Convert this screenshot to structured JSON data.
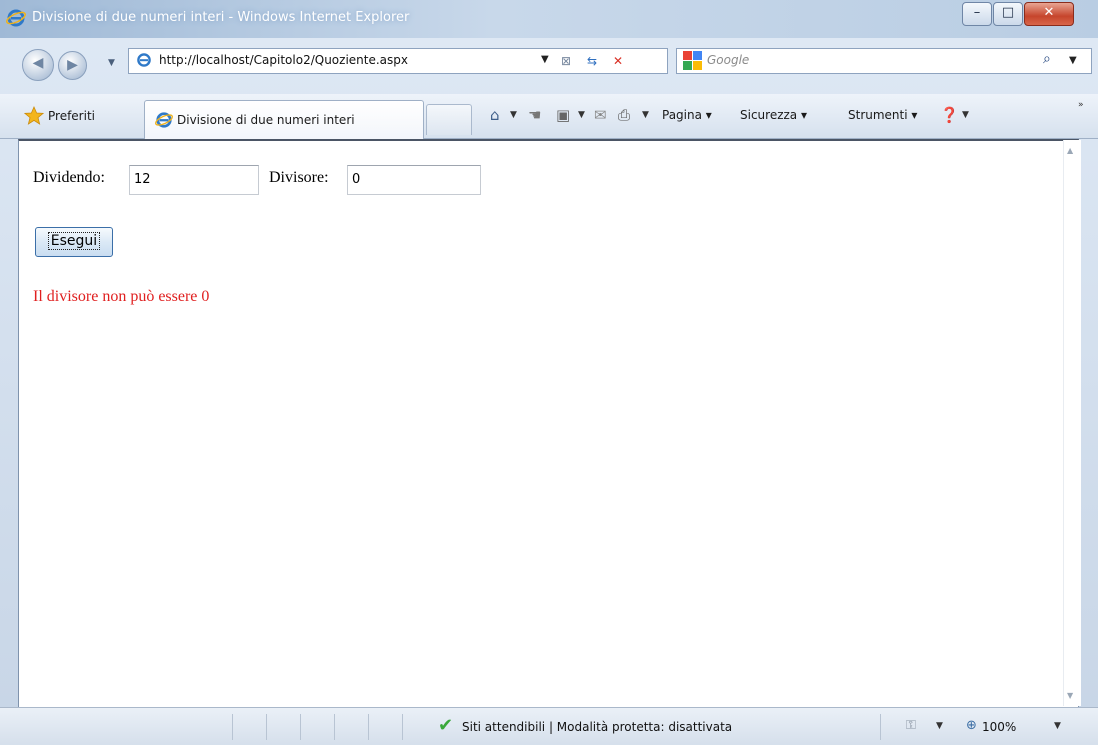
{
  "window": {
    "title": "Divisione di due numeri interi - Windows Internet Explorer",
    "minimize_glyph": "–",
    "maximize_glyph": "□",
    "close_glyph": "✕"
  },
  "address": {
    "url": "http://localhost/Capitolo2/Quoziente.aspx",
    "search_placeholder": "Google"
  },
  "favorites": {
    "label": "Preferiti"
  },
  "tab": {
    "label": "Divisione di due numeri interi"
  },
  "commandbar": {
    "pagina": "Pagina",
    "sicurezza": "Sicurezza",
    "strumenti": "Strumenti"
  },
  "form": {
    "dividendo_label": "Dividendo:",
    "dividendo_value": "12",
    "divisore_label": "Divisore:",
    "divisore_value": "0",
    "button_label": "Esegui",
    "error_message": "Il divisore non può essere 0",
    "error_color": "#e02020"
  },
  "statusbar": {
    "zone_text": "Siti attendibili | Modalità protetta: disattivata",
    "zoom": "100%"
  },
  "icons": [
    "ie-logo-icon",
    "back-arrow-icon",
    "forward-arrow-icon",
    "rss-icon",
    "refresh-icon",
    "stop-icon",
    "google-icon",
    "search-icon",
    "star-icon",
    "home-icon",
    "hand-icon",
    "feeds-icon",
    "mail-icon",
    "print-icon",
    "help-icon",
    "check-icon",
    "zone-icon",
    "zoom-icon"
  ]
}
